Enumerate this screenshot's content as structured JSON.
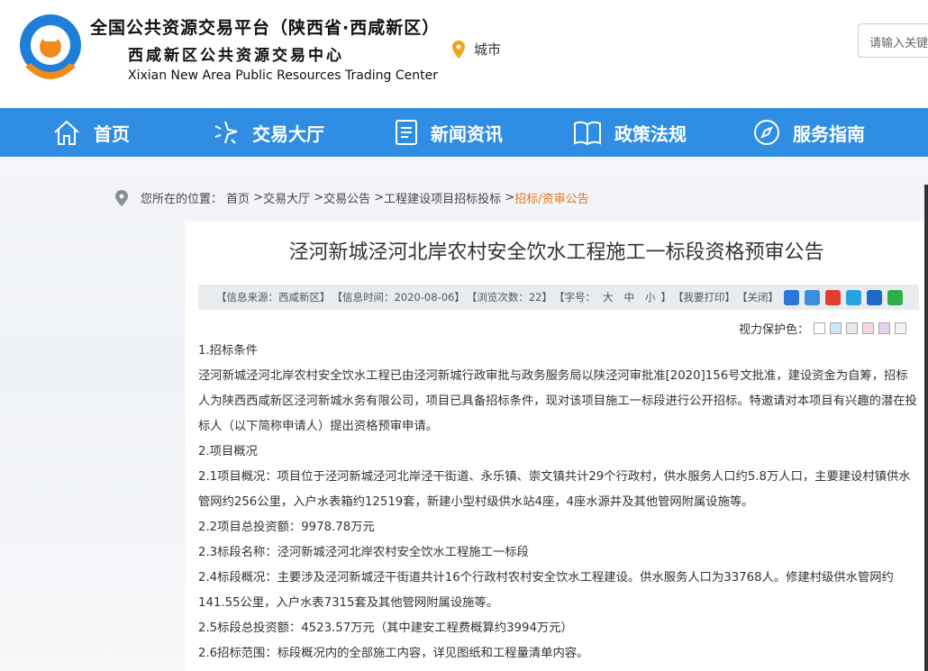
{
  "header": {
    "title_line1": "全国公共资源交易平台（陕西省·西咸新区）",
    "title_line2": "西咸新区公共资源交易中心",
    "title_line3": "Xixian New Area Public Resources Trading Center",
    "city_label": "城市",
    "search_placeholder": "请输入关键字"
  },
  "nav": {
    "items": [
      {
        "label": "首页",
        "icon": "home-icon"
      },
      {
        "label": "交易大厅",
        "icon": "sparkle-icon"
      },
      {
        "label": "新闻资讯",
        "icon": "document-icon"
      },
      {
        "label": "政策法规",
        "icon": "book-icon"
      },
      {
        "label": "服务指南",
        "icon": "compass-icon"
      }
    ]
  },
  "breadcrumb": {
    "prefix": "您所在的位置：",
    "items": [
      "首页",
      "交易大厅",
      "交易公告",
      "工程建设项目招标投标",
      "招标/资审公告"
    ]
  },
  "article": {
    "title": "泾河新城泾河北岸农村安全饮水工程施工一标段资格预审公告",
    "meta": {
      "source": "【信息来源：西咸新区】",
      "time": "【信息时间：2020-08-06】",
      "views": "【浏览次数：22】",
      "font_label": "【字号：",
      "font_big": "大",
      "font_mid": "中",
      "font_small": "小",
      "font_end": "】",
      "print": "【我要打印】",
      "close": "【关闭】"
    },
    "protect_label": "视力保护色：",
    "paragraphs": [
      "1.招标条件",
      "泾河新城泾河北岸农村安全饮水工程已由泾河新城行政审批与政务服务局以陕泾河审批准[2020]156号文批准，建设资金为自筹，招标人为陕西西咸新区泾河新城水务有限公司，项目已具备招标条件，现对该项目施工一标段进行公开招标。特邀请对本项目有兴趣的潜在投标人（以下简称申请人）提出资格预审申请。",
      "2.项目概况",
      "2.1项目概况：项目位于泾河新城泾河北岸泾干街道、永乐镇、崇文镇共计29个行政村，供水服务人口约5.8万人口，主要建设村镇供水管网约256公里，入户水表箱约12519套，新建小型村级供水站4座，4座水源井及其他管网附属设施等。",
      "2.2项目总投资额：9978.78万元",
      "2.3标段名称：泾河新城泾河北岸农村安全饮水工程施工一标段",
      "2.4标段概况：主要涉及泾河新城泾干街道共计16个行政村农村安全饮水工程建设。供水服务人口为33768人。修建村级供水管网约141.55公里，入户水表7315套及其他管网附属设施等。",
      "2.5标段总投资额：4523.57万元（其中建安工程费概算约3994万元）",
      "2.6招标范围：标段概况内的全部施工内容，详见图纸和工程量清单内容。"
    ]
  },
  "colors": {
    "nav_bg": "#2f8ee3",
    "logo_blue": "#1f7fd8",
    "logo_orange": "#f08a1c",
    "breadcrumb_active": "#e8731c"
  },
  "protect_swatches": [
    "#ffffff",
    "#cfe8f7",
    "#e8e8e8",
    "#f6d5dd",
    "#e3d3ec",
    "#f4f4f4"
  ],
  "share_colors": [
    "#2b76d6",
    "#3a8fe0",
    "#e03d2e",
    "#2aa1e0",
    "#1f68c9",
    "#2dae4a"
  ]
}
